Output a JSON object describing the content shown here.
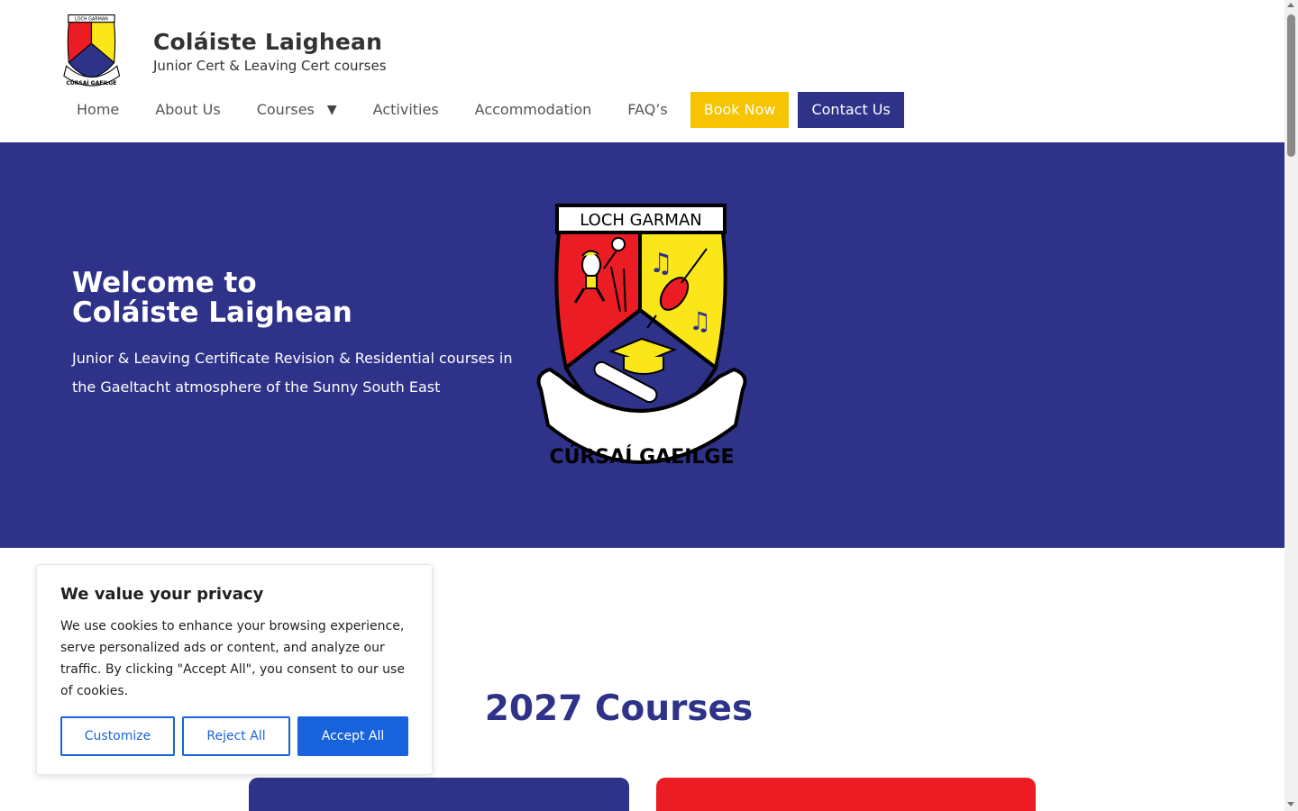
{
  "header": {
    "site_title": "Coláiste Laighean",
    "tagline": "Junior Cert & Leaving Cert courses",
    "logo_text_top": "LOCH GARMAN",
    "logo_text_bottom": "CÚRSAÍ GAEILGE"
  },
  "nav": {
    "items": [
      {
        "label": "Home"
      },
      {
        "label": "About Us"
      },
      {
        "label": "Courses",
        "has_dropdown": true
      },
      {
        "label": "Activities"
      },
      {
        "label": "Accommodation"
      },
      {
        "label": "FAQ’s"
      }
    ],
    "book_label": "Book Now",
    "contact_label": "Contact Us",
    "caret": "▼"
  },
  "hero": {
    "title_line1": "Welcome to",
    "title_line2": "Coláiste Laighean",
    "text": "Junior & Leaving Certificate Revision & Residential courses in the Gaeltacht atmosphere of the Sunny South East",
    "crest_top": "LOCH GARMAN",
    "crest_bottom": "CÚRSAÍ GAEILGE"
  },
  "courses": {
    "title": "2027 Courses"
  },
  "cookie": {
    "title": "We value your privacy",
    "text": "We use cookies to enhance your browsing experience, serve personalized ads or content, and analyze our traffic. By clicking \"Accept All\", you consent to our use of cookies.",
    "customize": "Customize",
    "reject": "Reject All",
    "accept": "Accept All"
  },
  "colors": {
    "brand_blue": "#2e3289",
    "brand_yellow": "#f6c400",
    "brand_red": "#ec1c24",
    "cookie_blue": "#1863dc"
  }
}
